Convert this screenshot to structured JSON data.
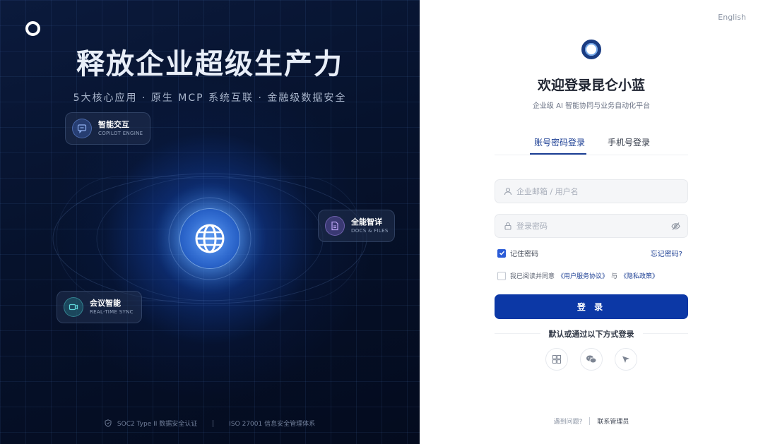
{
  "hero": {
    "title": "释放企业超级生产力",
    "subtitle": "5大核心应用 · 原生 MCP 系统互联 · 金融级数据安全"
  },
  "feature_cards": [
    {
      "title": "智能交互",
      "subtitle": "COPILOT ENGINE",
      "icon": "chat-icon",
      "color": "#6d8fe6"
    },
    {
      "title": "全能智详",
      "subtitle": "DOCS & FILES",
      "icon": "document-icon",
      "color": "#9b7de6"
    },
    {
      "title": "会议智能",
      "subtitle": "REAL-TIME SYNC",
      "icon": "video-icon",
      "color": "#3fc6c9"
    }
  ],
  "left_footer": {
    "item1": "SOC2 Type II 数据安全认证",
    "item2": "ISO 27001 信息安全管理体系"
  },
  "lang_switch": "English",
  "login": {
    "title": "欢迎登录昆仑小蓝",
    "tagline": "企业级 AI 智能协同与业务自动化平台",
    "tabs": [
      "账号密码登录",
      "手机号登录"
    ],
    "active_tab": 0,
    "username_placeholder": "企业邮箱 / 用户名",
    "password_placeholder": "登录密码",
    "remember_label": "记住密码",
    "remember_checked": true,
    "forgot_label": "忘记密码?",
    "agree_prefix": "我已阅读并同意",
    "terms_link": "《用户服务协议》",
    "and_text": "与",
    "privacy_link": "《隐私政策》",
    "agree_checked": false,
    "submit_label": "登 录",
    "alt_login_label": "默认或通过以下方式登录"
  },
  "social_logins": [
    "windows-icon",
    "wechat-icon",
    "feishu-icon"
  ],
  "right_footer": {
    "help": "遇到问题?",
    "contact": "联系管理员"
  },
  "colors": {
    "primary": "#0c38a6",
    "link": "#1c3f94",
    "left_bg": "#06122c"
  }
}
